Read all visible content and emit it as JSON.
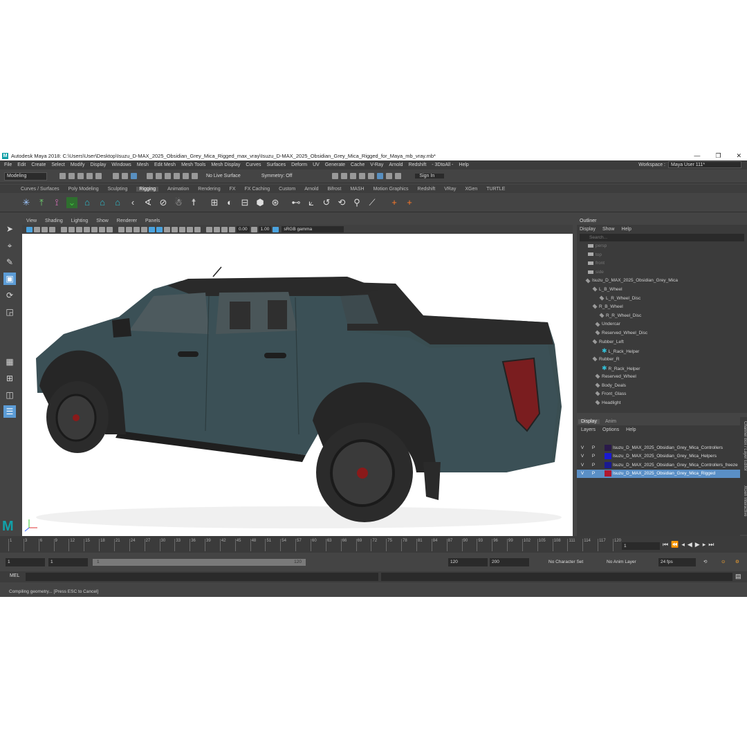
{
  "window": {
    "app_letter": "M",
    "title": "Autodesk Maya 2018: C:\\Users\\User\\Desktop\\Isuzu_D-MAX_2025_Obsidian_Grey_Mica_Rigged_max_vray\\Isuzu_D-MAX_2025_Obsidian_Grey_Mica_Rigged_for_Maya_mb_vray.mb*",
    "minimize": "—",
    "maximize": "❐",
    "close": "✕"
  },
  "menubar": {
    "items": [
      "File",
      "Edit",
      "Create",
      "Select",
      "Modify",
      "Display",
      "Windows",
      "Mesh",
      "Edit Mesh",
      "Mesh Tools",
      "Mesh Display",
      "Curves",
      "Surfaces",
      "Deform",
      "UV",
      "Generate",
      "Cache",
      "V-Ray",
      "Arnold",
      "Redshift",
      "- 3DtoAll -",
      "Help"
    ],
    "workspace_label": "Workspace :",
    "workspace_value": "Maya User 111*"
  },
  "statusline": {
    "mode": "Modeling",
    "live_surface": "No Live Surface",
    "symmetry": "Symmetry: Off",
    "sign_in": "Sign In"
  },
  "shelf": {
    "tabs": [
      "Curves / Surfaces",
      "Poly Modeling",
      "Sculpting",
      "Rigging",
      "Animation",
      "Rendering",
      "FX",
      "FX Caching",
      "Custom",
      "Arnold",
      "Bifrost",
      "MASH",
      "Motion Graphics",
      "Redshift",
      "VRay",
      "XGen",
      "TURTLE"
    ],
    "active_tab": "Rigging"
  },
  "panel": {
    "menu": [
      "View",
      "Shading",
      "Lighting",
      "Show",
      "Renderer",
      "Panels"
    ],
    "exposure": "0.00",
    "gamma": "1.00",
    "color_space": "sRGB gamma"
  },
  "outliner": {
    "title": "Outliner",
    "menu": [
      "Display",
      "Show",
      "Help"
    ],
    "search_placeholder": "Search...",
    "items": [
      {
        "label": "persp",
        "indent": 16,
        "kind": "cam",
        "dim": true
      },
      {
        "label": "top",
        "indent": 16,
        "kind": "cam",
        "dim": true
      },
      {
        "label": "front",
        "indent": 16,
        "kind": "cam",
        "dim": true
      },
      {
        "label": "side",
        "indent": 16,
        "kind": "cam",
        "dim": true
      },
      {
        "label": "Isuzu_D_MAX_2025_Obsidian_Grey_Mica",
        "indent": 12,
        "kind": "grp",
        "dim": false
      },
      {
        "label": "L_B_Wheel",
        "indent": 22,
        "kind": "grp",
        "dim": false
      },
      {
        "label": "L_R_Wheel_Disc",
        "indent": 32,
        "kind": "grp",
        "dim": false
      },
      {
        "label": "R_B_Wheel",
        "indent": 22,
        "kind": "grp",
        "dim": false
      },
      {
        "label": "R_R_Wheel_Disc",
        "indent": 32,
        "kind": "grp",
        "dim": false
      },
      {
        "label": "Undercar",
        "indent": 26,
        "kind": "grp",
        "dim": false
      },
      {
        "label": "Reserved_Wheel_Disc",
        "indent": 26,
        "kind": "grp",
        "dim": false
      },
      {
        "label": "Rubber_Left",
        "indent": 22,
        "kind": "grp",
        "dim": false
      },
      {
        "label": "L_Rack_Helper",
        "indent": 36,
        "kind": "star",
        "dim": false
      },
      {
        "label": "Rubber_R",
        "indent": 22,
        "kind": "grp",
        "dim": false
      },
      {
        "label": "R_Rack_Helper",
        "indent": 36,
        "kind": "star",
        "dim": false
      },
      {
        "label": "Reserved_Wheel",
        "indent": 26,
        "kind": "grp",
        "dim": false
      },
      {
        "label": "Body_Deals",
        "indent": 26,
        "kind": "grp",
        "dim": false
      },
      {
        "label": "Front_Glass",
        "indent": 26,
        "kind": "grp",
        "dim": false
      },
      {
        "label": "Headlight",
        "indent": 26,
        "kind": "grp",
        "dim": false
      }
    ]
  },
  "layers": {
    "tabs": [
      "Display",
      "Anim"
    ],
    "active_tab": "Display",
    "menu": [
      "Layers",
      "Options",
      "Help"
    ],
    "rows": [
      {
        "v": "V",
        "p": "P",
        "color": "#2a1a4a",
        "name": "Isuzu_D_MAX_2025_Obsidian_Grey_Mica_Controllers",
        "selected": false
      },
      {
        "v": "V",
        "p": "P",
        "color": "#1a1ad0",
        "name": "Isuzu_D_MAX_2025_Obsidian_Grey_Mica_Helpers",
        "selected": false
      },
      {
        "v": "V",
        "p": "P",
        "color": "#1a1a90",
        "name": "Isuzu_D_MAX_2025_Obsidian_Grey_Mica_Controllers_freeze",
        "selected": false
      },
      {
        "v": "V",
        "p": "P",
        "color": "#b01830",
        "name": "Isuzu_D_MAX_2025_Obsidian_Grey_Mica_Rigged",
        "selected": true
      }
    ],
    "side_label": "Channel Box / Layer Editor",
    "side_label2": "XGen Interactive"
  },
  "timeline": {
    "ticks": [
      "1",
      "3",
      "6",
      "9",
      "12",
      "15",
      "18",
      "21",
      "24",
      "27",
      "30",
      "33",
      "36",
      "39",
      "42",
      "45",
      "48",
      "51",
      "54",
      "57",
      "60",
      "63",
      "66",
      "69",
      "72",
      "75",
      "78",
      "81",
      "84",
      "87",
      "90",
      "93",
      "96",
      "99",
      "102",
      "105",
      "108",
      "111",
      "114",
      "117",
      "120"
    ],
    "current_frame": "1",
    "range_start": "1",
    "range_start2": "1",
    "slider_start": "1",
    "slider_end": "120",
    "range_end": "120",
    "anim_end": "200",
    "character_set": "No Character Set",
    "anim_layer": "No Anim Layer",
    "fps": "24 fps"
  },
  "command": {
    "label": "MEL",
    "help": "Compiling geometry... [Press ESC to Cancel]"
  },
  "colors": {
    "accent": "#5c9cd6",
    "maya_teal": "#11a1a9",
    "car_body": "#3a4e52"
  }
}
